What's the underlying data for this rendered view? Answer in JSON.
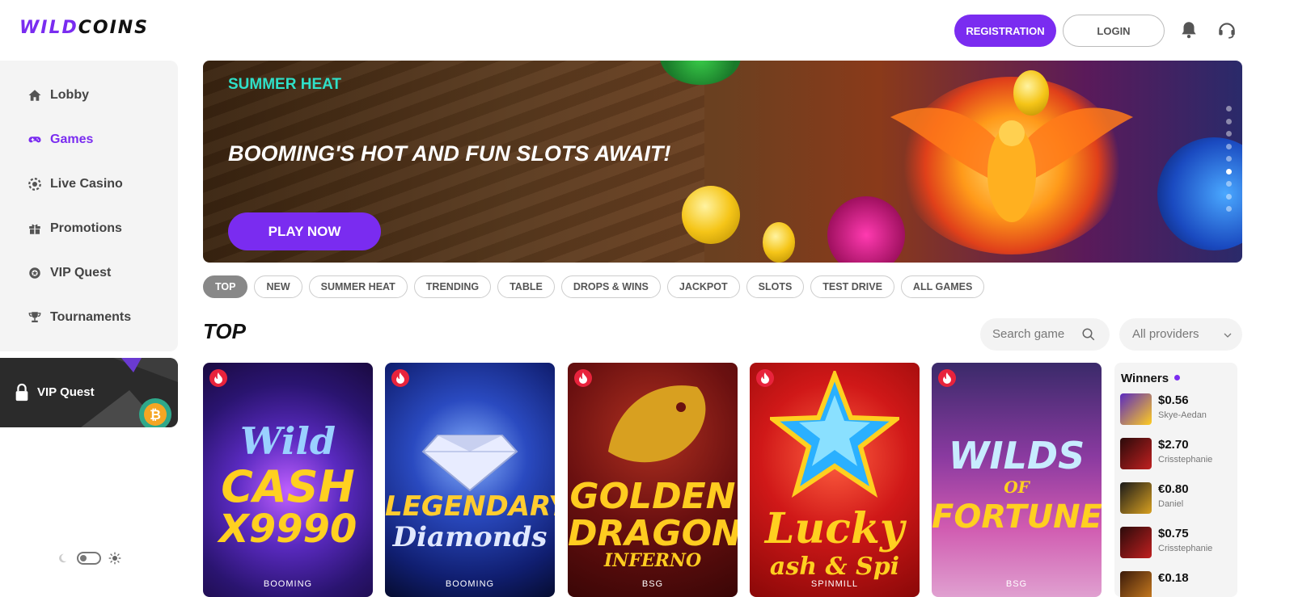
{
  "header": {
    "logo_wild": "WILD",
    "logo_coins": "COINS",
    "registration_label": "REGISTRATION",
    "login_label": "LOGIN",
    "icons": [
      "bell-icon",
      "headset-icon"
    ]
  },
  "sidebar": {
    "items": [
      {
        "label": "Lobby",
        "icon": "home-icon"
      },
      {
        "label": "Games",
        "icon": "gamepad-icon",
        "active": true
      },
      {
        "label": "Live Casino",
        "icon": "chip-icon"
      },
      {
        "label": "Promotions",
        "icon": "gift-icon"
      },
      {
        "label": "VIP Quest",
        "icon": "badge-icon"
      },
      {
        "label": "Tournaments",
        "icon": "trophy-icon"
      }
    ],
    "vip_banner_label": "VIP Quest",
    "theme_toggle": {
      "icons": [
        "moon-icon",
        "sun-icon"
      ]
    }
  },
  "hero": {
    "tag": "SUMMER HEAT",
    "headline": "BOOMING'S HOT AND FUN SLOTS AWAIT!",
    "cta_label": "PLAY NOW",
    "slide_count": 9,
    "active_slide": 6
  },
  "filters": [
    "TOP",
    "NEW",
    "SUMMER HEAT",
    "TRENDING",
    "TABLE",
    "DROPS & WINS",
    "JACKPOT",
    "SLOTS",
    "TEST DRIVE",
    "ALL GAMES"
  ],
  "active_filter": "TOP",
  "section": {
    "title": "TOP",
    "search_placeholder": "Search game",
    "providers_value": "All providers"
  },
  "games": [
    {
      "line1": "Wild",
      "line2": "CASH",
      "line3": "X9990",
      "provider": "BOOMING"
    },
    {
      "line1": "",
      "line2": "LEGENDARY",
      "line3": "Diamonds",
      "provider": "BOOMING"
    },
    {
      "line1": "GOLDEN",
      "line2": "DRAGON",
      "line3": "INFERNO",
      "provider": "BSG"
    },
    {
      "line1": "",
      "line2": "Lucky",
      "line3": "ash & Spi",
      "provider": "SPINMILL"
    },
    {
      "line1": "WILDS",
      "line2": "OF",
      "line3": "FORTUNE",
      "provider": "BSG"
    }
  ],
  "winners": {
    "title": "Winners",
    "rows": [
      {
        "amount": "$0.56",
        "user": "Skye-Aedan"
      },
      {
        "amount": "$2.70",
        "user": "Crisstephanie"
      },
      {
        "amount": "€0.80",
        "user": "Daniel"
      },
      {
        "amount": "$0.75",
        "user": "Crisstephanie"
      },
      {
        "amount": "€0.18",
        "user": ""
      }
    ]
  },
  "colors": {
    "brand": "#7a2cf0",
    "hero_tag": "#2fe0c8",
    "fire_badge": "#e8233c"
  }
}
